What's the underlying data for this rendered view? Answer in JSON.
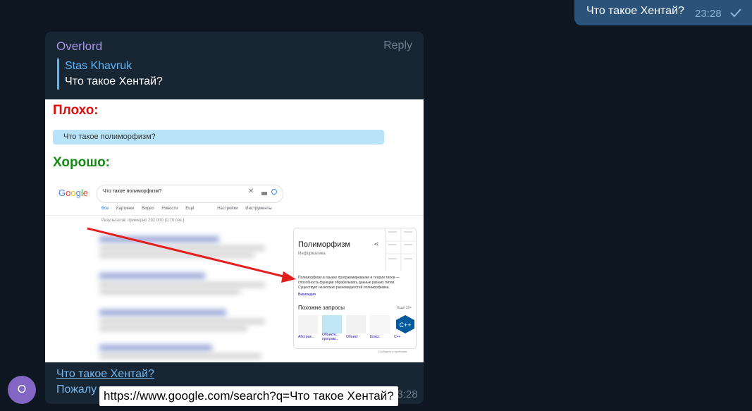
{
  "outgoing": {
    "text": "Что такое Хентай?",
    "time": "23:28",
    "check_icon": "check-icon"
  },
  "incoming": {
    "sender": "Overlord",
    "reply_label": "Reply",
    "quote": {
      "name": "Stas Khavruk",
      "text": "Что такое Хентай?"
    },
    "caption_link": "Что такое Хентай?",
    "caption_text": "Пожалу",
    "time": "23:28"
  },
  "image": {
    "bad_label": "Плохо:",
    "bad_bubble_text": "Что такое полиморфизм?",
    "good_label": "Хорошо:",
    "google_logo": "Google",
    "search_query": "Что такое полиморфизм?",
    "tabs": [
      "Все",
      "Картинки",
      "Видео",
      "Новости",
      "Ещё",
      "Настройки",
      "Инструменты"
    ],
    "results_count": "Результатов: примерно 292 000 (0,70 сек.)",
    "kp_title": "Полиморфизм",
    "kp_subtitle": "Информатика",
    "kp_description": "Полиморфизм в языках программирования и теории типов — способность функции обрабатывать данные разных типов. Существует несколько разновидностей полиморфизма.",
    "kp_wiki": "Википедия",
    "kp_related": "Похожие запросы",
    "kp_more": "Ещё 15+",
    "kp_thumb_labels": [
      "Абстрак...",
      "Объектн... програм...",
      "Объект",
      "Класс",
      "C++"
    ],
    "kp_feedback": "Сообщить о проблеме",
    "colors": {
      "bad": "#e01010",
      "good": "#148c14",
      "arrow": "#e41e1e"
    }
  },
  "avatar_letter": "O",
  "tooltip_url": "https://www.google.com/search?q=Что такое Хентай?"
}
